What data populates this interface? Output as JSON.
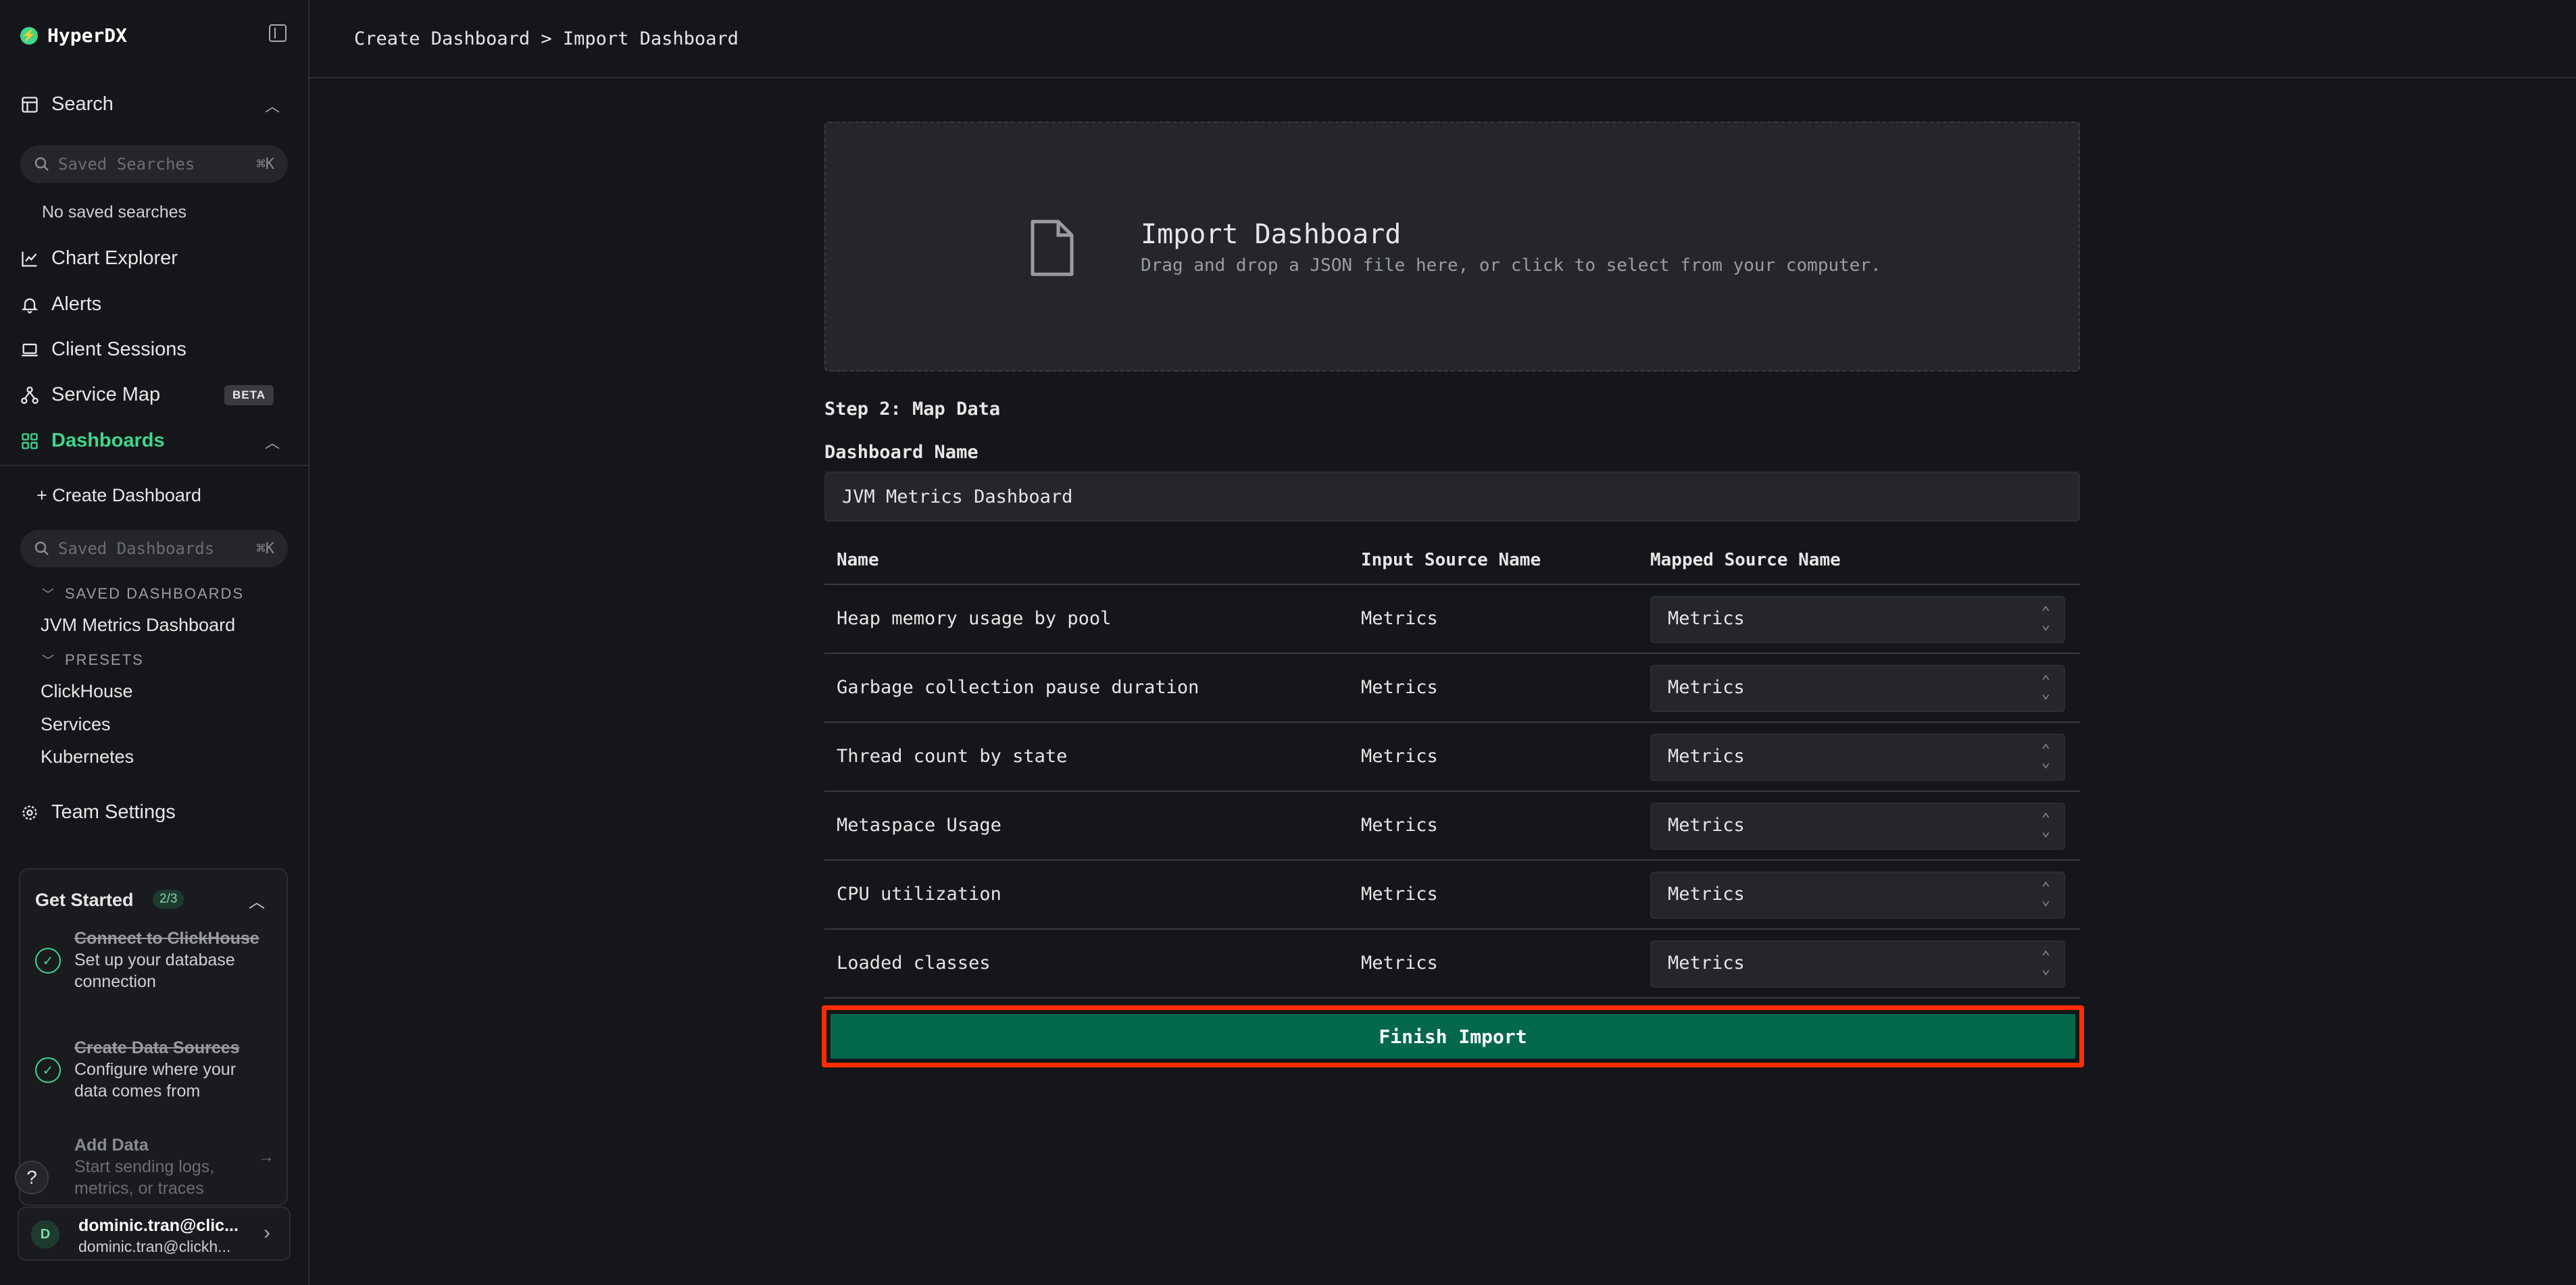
{
  "app": {
    "brand": "HyperDX"
  },
  "sidebar": {
    "search_label": "Search",
    "saved_searches_placeholder": "Saved Searches",
    "saved_searches_kbd": "⌘K",
    "no_saved_searches": "No saved searches",
    "items": [
      {
        "label": "Chart Explorer"
      },
      {
        "label": "Alerts"
      },
      {
        "label": "Client Sessions"
      },
      {
        "label": "Service Map",
        "badge": "BETA"
      },
      {
        "label": "Dashboards"
      }
    ],
    "create_dashboard": "+ Create Dashboard",
    "saved_dashboards_placeholder": "Saved Dashboards",
    "saved_dashboards_kbd": "⌘K",
    "saved_dashboards_heading": "SAVED DASHBOARDS",
    "saved_dashboards": [
      "JVM Metrics Dashboard"
    ],
    "presets_heading": "PRESETS",
    "presets": [
      "ClickHouse",
      "Services",
      "Kubernetes"
    ],
    "team_settings": "Team Settings",
    "accent_color": "#3fd68b"
  },
  "get_started": {
    "title": "Get Started",
    "count": "2/3",
    "steps": [
      {
        "title": "Connect to ClickHouse",
        "desc": "Set up your database connection",
        "done": true
      },
      {
        "title": "Create Data Sources",
        "desc": "Configure where your data comes from",
        "done": true
      },
      {
        "title": "Add Data",
        "desc": "Start sending logs, metrics, or traces",
        "done": false
      }
    ]
  },
  "user": {
    "avatar": "D",
    "name": "dominic.tran@clic...",
    "email": "dominic.tran@clickh..."
  },
  "header": {
    "breadcrumb": "Create Dashboard > Import Dashboard"
  },
  "import": {
    "title": "Import Dashboard",
    "subtitle": "Drag and drop a JSON file here, or click to select from your computer."
  },
  "form": {
    "step_label": "Step 2: Map Data",
    "dashboard_name_label": "Dashboard Name",
    "dashboard_name_value": "JVM Metrics Dashboard",
    "columns": [
      "Name",
      "Input Source Name",
      "Mapped Source Name"
    ],
    "rows": [
      {
        "name": "Heap memory usage by pool",
        "input": "Metrics",
        "mapped": "Metrics"
      },
      {
        "name": "Garbage collection pause duration",
        "input": "Metrics",
        "mapped": "Metrics"
      },
      {
        "name": "Thread count by state",
        "input": "Metrics",
        "mapped": "Metrics"
      },
      {
        "name": "Metaspace Usage",
        "input": "Metrics",
        "mapped": "Metrics"
      },
      {
        "name": "CPU utilization",
        "input": "Metrics",
        "mapped": "Metrics"
      },
      {
        "name": "Loaded classes",
        "input": "Metrics",
        "mapped": "Metrics"
      }
    ],
    "finish_label": "Finish Import",
    "finish_color": "#04684d",
    "highlight_color": "#ff2d00"
  }
}
